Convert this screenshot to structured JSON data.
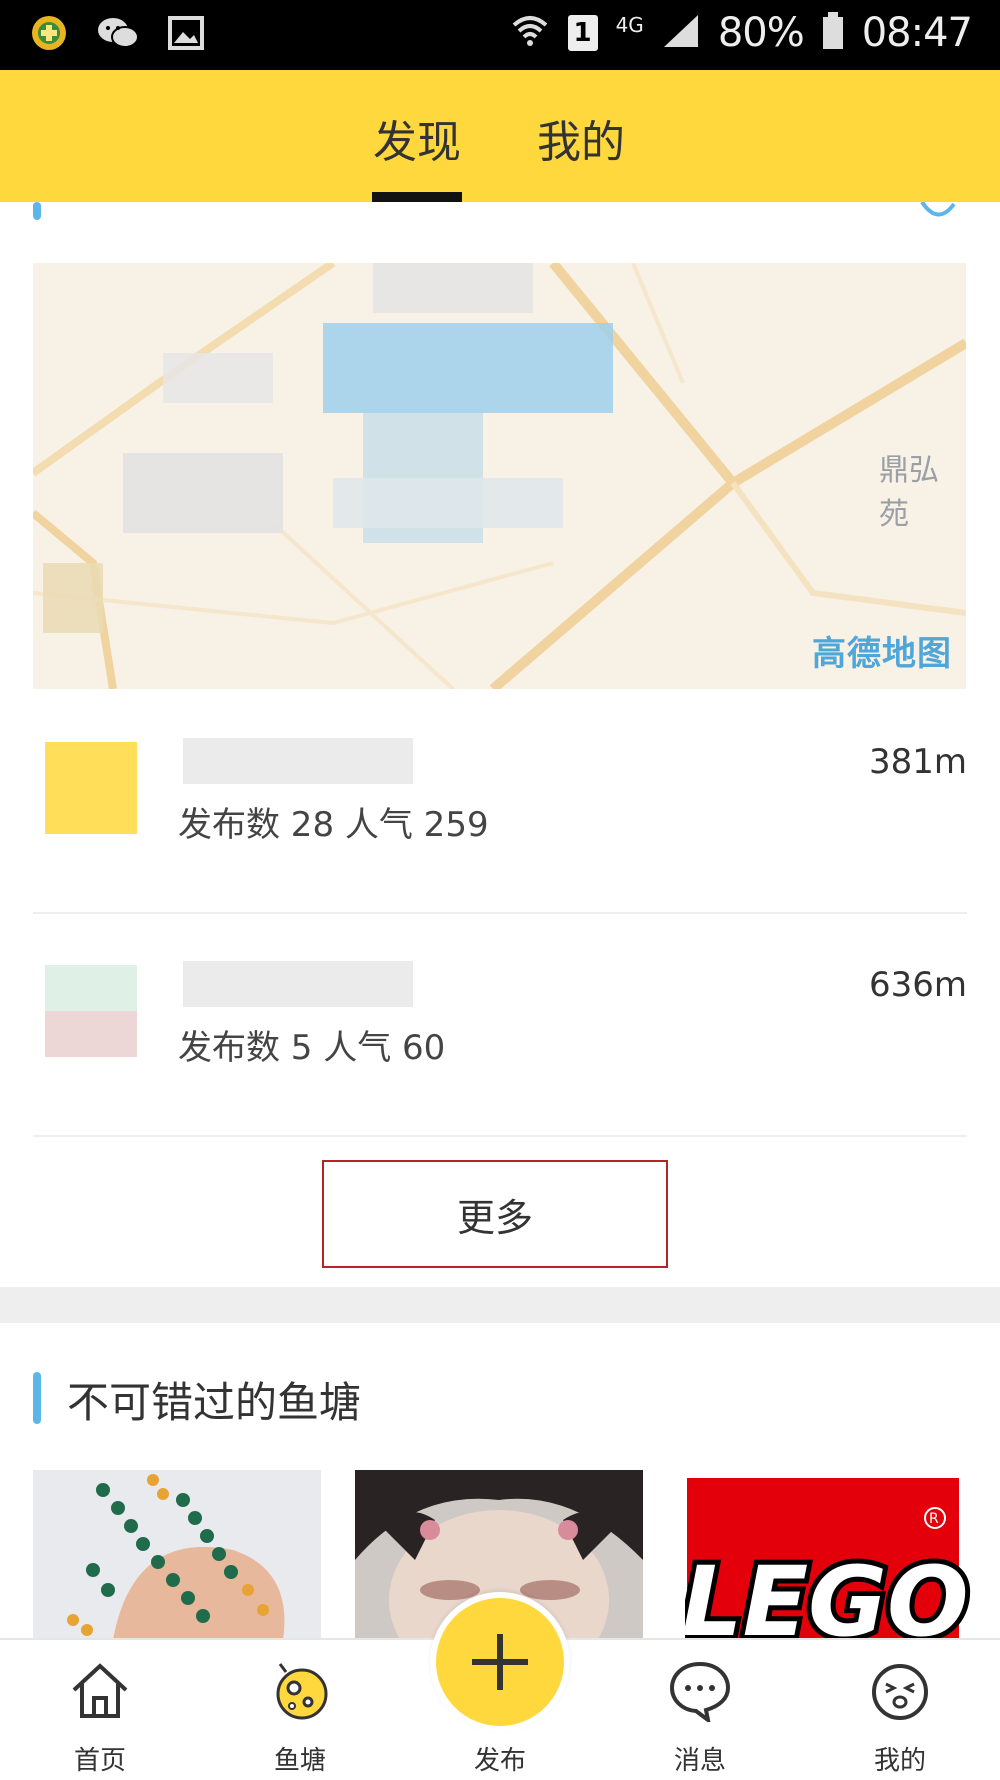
{
  "status_bar": {
    "battery": "80%",
    "time": "08:47",
    "sim_label": "1",
    "network": "4G",
    "icons": [
      "app-icon",
      "wechat-icon",
      "gallery-icon",
      "wifi-icon",
      "sim-icon",
      "signal-icon",
      "battery-icon"
    ]
  },
  "header": {
    "tabs": [
      {
        "label": "发现",
        "active": true
      },
      {
        "label": "我的",
        "active": false
      }
    ],
    "background_color": "#ffd83e"
  },
  "nearby": {
    "map": {
      "attribution": "高德地图",
      "labels": [
        "鼎弘苑"
      ]
    },
    "ponds": [
      {
        "stats": "发布数 28  人气 259",
        "distance": "381m"
      },
      {
        "stats": "发布数 5  人气 60",
        "distance": "636m"
      }
    ],
    "more_label": "更多"
  },
  "must_see": {
    "title": "不可错过的鱼塘",
    "items": [
      "beads-image",
      "face-image",
      "lego-image"
    ],
    "lego_text": "LEGO"
  },
  "bottom_nav": {
    "items": [
      {
        "label": "首页",
        "icon": "home-icon"
      },
      {
        "label": "鱼塘",
        "icon": "pond-icon"
      },
      {
        "label": "发布",
        "icon": "plus-icon"
      },
      {
        "label": "消息",
        "icon": "message-icon"
      },
      {
        "label": "我的",
        "icon": "profile-icon"
      }
    ]
  },
  "accent_colors": {
    "yellow": "#ffd83e",
    "blue": "#5bb6ea",
    "highlight_red": "#b3232a"
  }
}
